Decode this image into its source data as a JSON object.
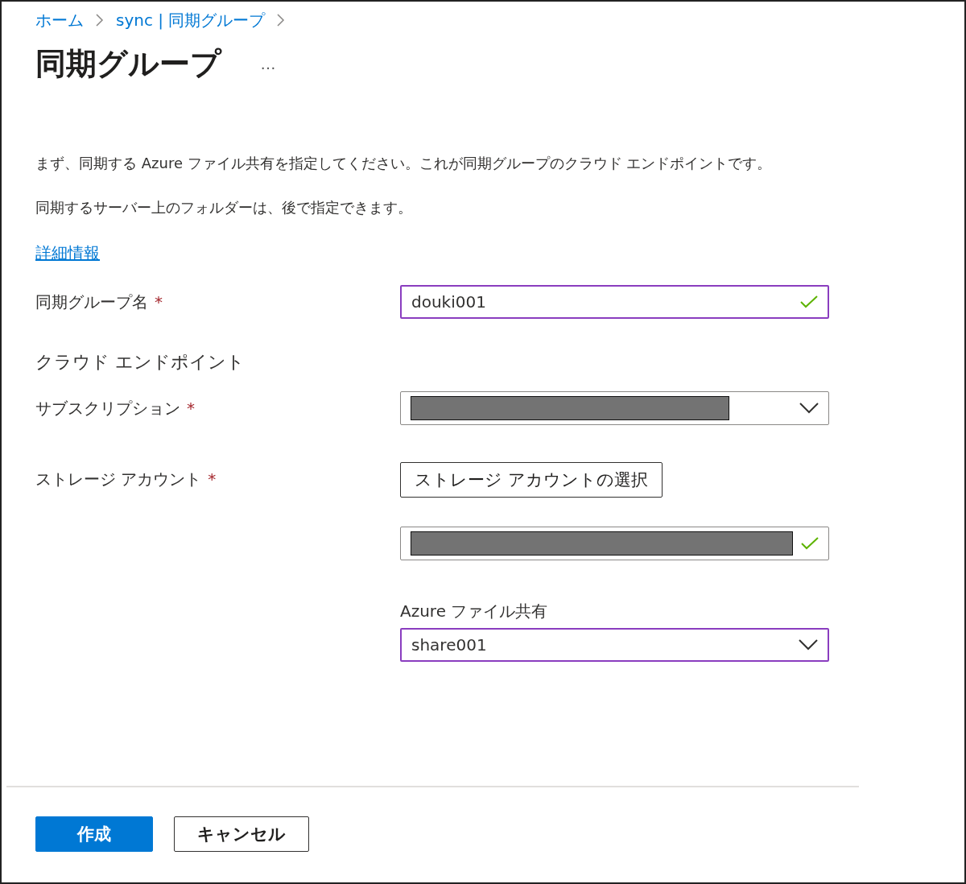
{
  "breadcrumb": [
    {
      "label": "ホーム"
    },
    {
      "label": "sync | 同期グループ"
    }
  ],
  "title": "同期グループ",
  "more": "…",
  "intro": [
    "まず、同期する Azure ファイル共有を指定してください。これが同期グループのクラウド エンドポイントです。",
    "同期するサーバー上のフォルダーは、後で指定できます。"
  ],
  "learn_more": "詳細情報",
  "form": [
    {
      "kind": "text",
      "label": "同期グループ名",
      "required_mark": "*",
      "value": "douki001",
      "valid": true,
      "focused": true
    },
    {
      "kind": "heading",
      "label": "クラウド エンドポイント"
    },
    {
      "kind": "dropdown",
      "label": "サブスクリプション",
      "required_mark": "*",
      "redacted": true,
      "focused": false
    },
    {
      "kind": "picker",
      "label": "ストレージ アカウント",
      "required_mark": "*",
      "button": "ストレージ アカウントの選択",
      "redacted": true,
      "valid": true,
      "focused": false
    },
    {
      "kind": "dropdown",
      "caption": "Azure ファイル共有",
      "value": "share001",
      "redacted": false,
      "focused": true
    }
  ],
  "buttons": [
    {
      "label": "作成",
      "primary": true
    },
    {
      "label": "キャンセル",
      "primary": false
    }
  ]
}
